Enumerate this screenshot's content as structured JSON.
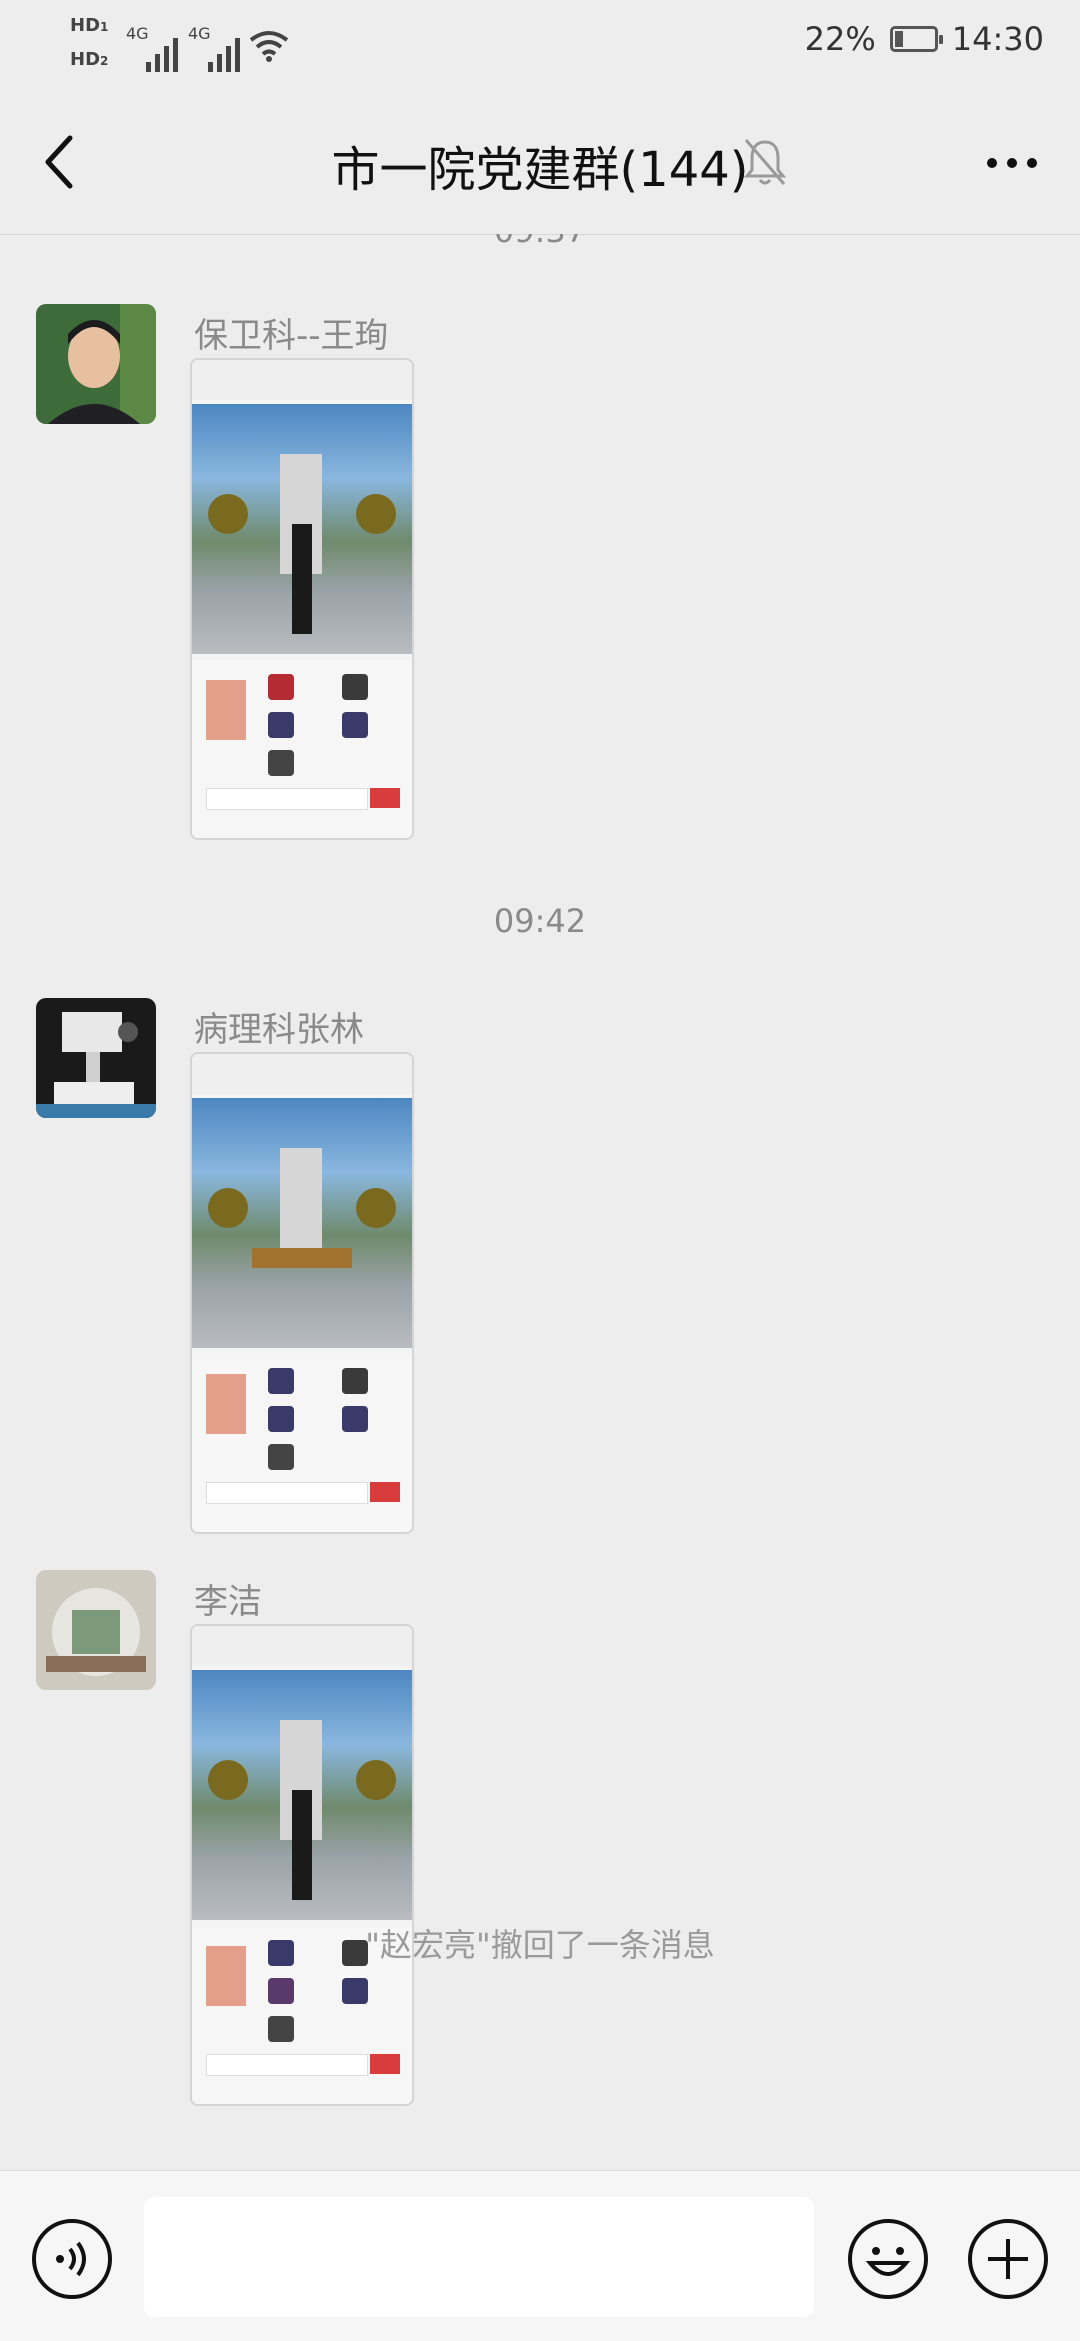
{
  "status_bar": {
    "sim1_label": "HD",
    "sim1_num": "1",
    "sim2_label": "HD",
    "sim2_num": "2",
    "net1": "4G",
    "net2": "4G",
    "battery_percent": "22%",
    "battery_level": 0.22,
    "time": "14:30"
  },
  "nav": {
    "title": "市一院党建群(144)",
    "back_icon": "chevron-left-icon",
    "mute_icon": "bell-muted-icon",
    "more_icon": "more-dots-icon"
  },
  "chat": {
    "partial_time": "09:37",
    "time_divider": "09:42",
    "messages": [
      {
        "sender": "保卫科--王珣",
        "type": "image"
      },
      {
        "sender": "病理科张林",
        "type": "image"
      },
      {
        "sender": "李洁",
        "type": "image"
      }
    ],
    "recall_notice": "\"赵宏亮\"撤回了一条消息"
  },
  "input_bar": {
    "voice_icon": "voice-icon",
    "emoji_icon": "emoji-icon",
    "plus_icon": "plus-circle-icon",
    "input_value": ""
  },
  "colors": {
    "background": "#ededed",
    "accent": "#d93c3c"
  }
}
